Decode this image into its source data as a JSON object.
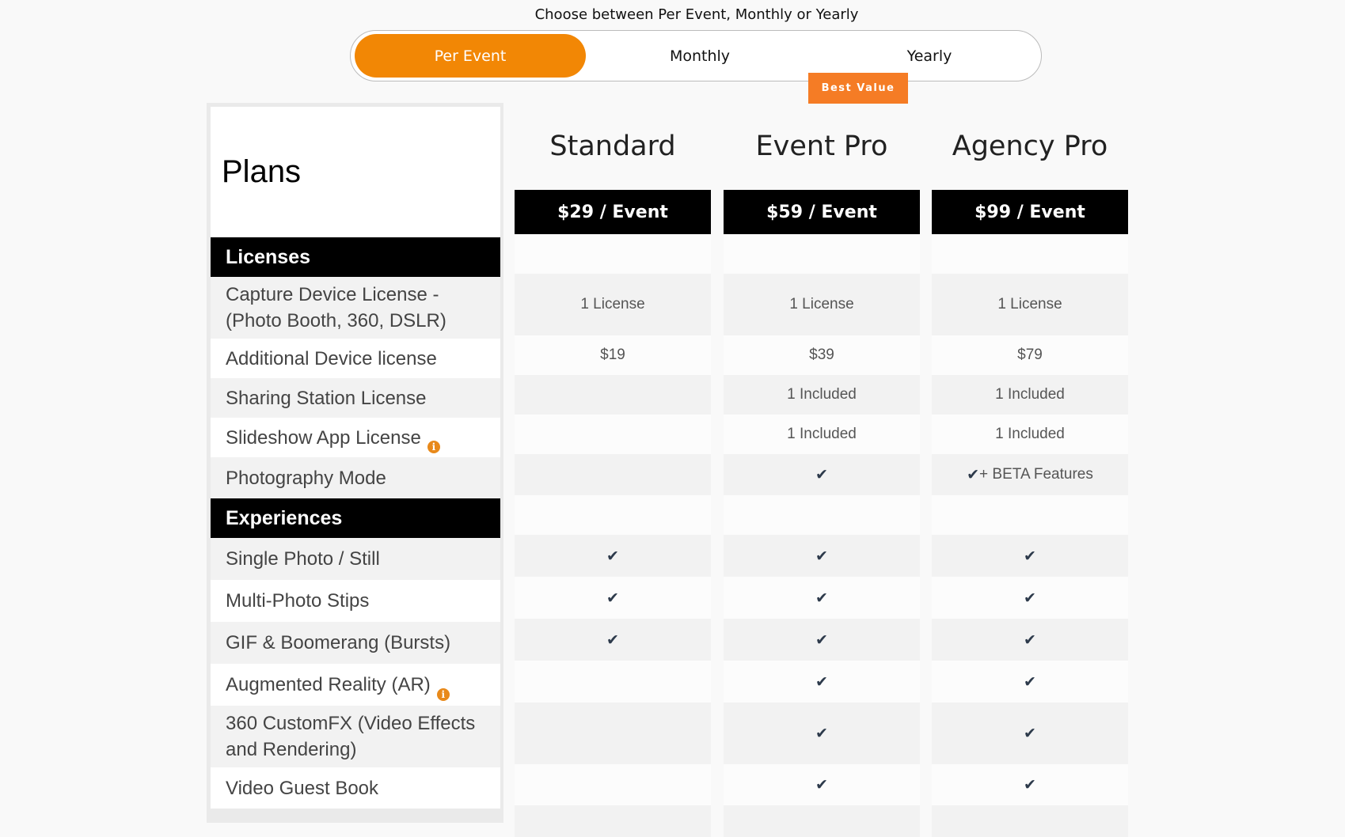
{
  "toggle": {
    "caption": "Choose between Per Event, Monthly or Yearly",
    "options": [
      "Per Event",
      "Monthly",
      "Yearly"
    ],
    "active": "Per Event",
    "badge": "Best Value"
  },
  "table": {
    "plans_title": "Plans",
    "plans": [
      {
        "name": "Standard",
        "price": "$29 / Event"
      },
      {
        "name": "Event Pro",
        "price": "$59 / Event"
      },
      {
        "name": "Agency Pro",
        "price": "$99 / Event"
      }
    ],
    "sections": {
      "licenses": "Licenses",
      "experiences": "Experiences"
    },
    "rows": [
      {
        "label": "Capture Device License - (Photo Booth, 360, DSLR)",
        "values": [
          "1 License",
          "1 License",
          "1 License"
        ]
      },
      {
        "label": "Additional Device license",
        "values": [
          "$19",
          "$39",
          "$79"
        ]
      },
      {
        "label": "Sharing Station License",
        "values": [
          "",
          "1 Included",
          "1 Included"
        ]
      },
      {
        "label": "Slideshow App License",
        "values": [
          "",
          "1 Included",
          "1 Included"
        ]
      },
      {
        "label": "Photography Mode",
        "values": [
          "",
          "",
          " + BETA Features"
        ]
      },
      {
        "label": "Single Photo / Still"
      },
      {
        "label": "Multi-Photo Stips"
      },
      {
        "label": "GIF & Boomerang (Bursts)"
      },
      {
        "label": "Augmented Reality (AR)"
      },
      {
        "label": "360 CustomFX (Video Effects and Rendering)"
      },
      {
        "label": "Video Guest Book"
      }
    ]
  },
  "icons": {
    "check": "check-icon",
    "info": "info-icon"
  },
  "colors": {
    "accent": "#f28705",
    "badge": "#f57c25",
    "header_bg": "#000000"
  }
}
